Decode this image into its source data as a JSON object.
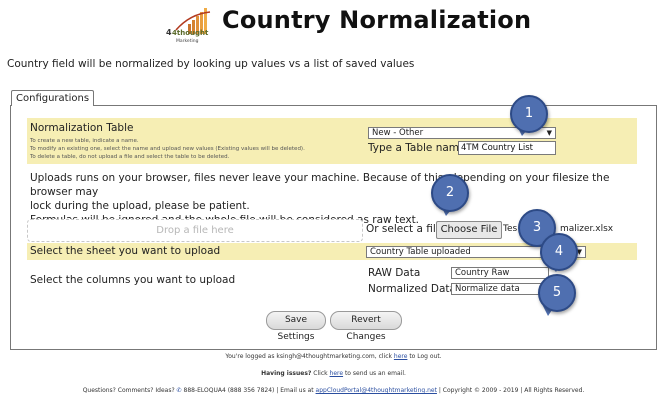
{
  "header": {
    "title": "Country Normalization",
    "logo_text_main": "4thought",
    "logo_text_sub": "Marketing"
  },
  "intro": "Country field will be normalized by looking up values vs a list of saved values",
  "tabs": [
    {
      "label": "Configurations"
    }
  ],
  "normalization": {
    "label": "Normalization Table",
    "help": [
      "To create a new table, indicate a name.",
      "To modify an existing one, select the name and upload new values (Existing values will be deleted).",
      "To delete a table, do not upload a file and select the table to be deleted."
    ],
    "table_select_value": "New - Other",
    "type_name_label": "Type a Table name",
    "table_name_value": "4TM Country List"
  },
  "upload": {
    "note_lines": [
      "Uploads runs on your browser, files never leave your machine. Because of this, depending on your filesize the browser may",
      "lock during the upload, please be patient.",
      "Formulas will be ignored and the whole file will be considered as raw text."
    ],
    "dropzone": "Drop a file here",
    "or_select": "Or select a file",
    "choose_file": "Choose File",
    "file_name_start": "Tes",
    "file_name_end": "malizer.xlsx"
  },
  "sheet": {
    "label": "Select the sheet you want to upload",
    "value": "Country Table uploaded"
  },
  "columns": {
    "label": "Select the columns you want to upload",
    "raw_label": "RAW Data",
    "raw_value": "Country Raw",
    "norm_label": "Normalized Data",
    "norm_value": "Normalize data"
  },
  "buttons": {
    "save": "Save Settings",
    "revert": "Revert Changes"
  },
  "callouts": [
    "1",
    "2",
    "3",
    "4",
    "5"
  ],
  "footer": {
    "logged_prefix": "You're logged as ksingh@4thoughtmarketing.com, click ",
    "logged_link": "here",
    "logged_suffix": " to Log out.",
    "issues_bold": "Having issues?",
    "issues_prefix": " Click ",
    "issues_link": "here",
    "issues_suffix": " to send us an email.",
    "contact_prefix": "Questions? Comments? Ideas? ",
    "phone": "888-ELOQUA4 (888 356 7824)",
    "email_prefix": " | Email us at ",
    "email": "appCloudPortal@4thoughtmarketing.net",
    "copyright": " | Copyright © 2009 - 2019 | All Rights Reserved."
  },
  "colors": {
    "row_highlight": "#f6eeb4",
    "callout": "#4f6fb0",
    "link": "#2a4ea0"
  }
}
